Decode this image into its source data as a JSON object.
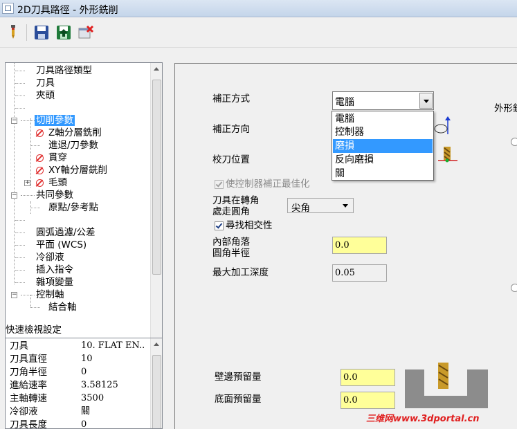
{
  "window": {
    "title": "2D刀具路徑 - 外形銑削"
  },
  "toolbar": {
    "icons": [
      "tool-icon",
      "save-icon",
      "save-green-icon",
      "delete-icon"
    ]
  },
  "tree": {
    "items": [
      {
        "label": "刀具路徑類型"
      },
      {
        "label": "刀具"
      },
      {
        "label": "夾頭"
      },
      {
        "label": "切削參數",
        "selected": true
      },
      {
        "label": "Z軸分層銑削"
      },
      {
        "label": "進退/刀參數"
      },
      {
        "label": "貫穿"
      },
      {
        "label": "XY軸分層銑削"
      },
      {
        "label": "毛頭"
      },
      {
        "label": "共同參數"
      },
      {
        "label": "原點/參考點"
      },
      {
        "label": "圓弧過濾/公差"
      },
      {
        "label": "平面 (WCS)"
      },
      {
        "label": "冷卻液"
      },
      {
        "label": "插入指令"
      },
      {
        "label": "雜項變量"
      },
      {
        "label": "控制軸"
      },
      {
        "label": "結合軸"
      }
    ]
  },
  "quickview": {
    "title": "快速檢視設定",
    "rows": [
      {
        "k": "刀具",
        "v": "10. FLAT EN.."
      },
      {
        "k": "刀具直徑",
        "v": "10"
      },
      {
        "k": "刀角半徑",
        "v": "0"
      },
      {
        "k": "進給速率",
        "v": "3.58125"
      },
      {
        "k": "主軸轉速",
        "v": "3500"
      },
      {
        "k": "冷卻液",
        "v": "關"
      },
      {
        "k": "刀具長度",
        "v": "0"
      }
    ]
  },
  "params": {
    "comp_type_label": "補正方式",
    "comp_type_value": "電腦",
    "comp_options": [
      "電腦",
      "控制器",
      "磨損",
      "反向磨損",
      "關"
    ],
    "comp_selected_index": 2,
    "comp_dir_label": "補正方向",
    "tip_label": "校刀位置",
    "optimize_label": "使控制器補正最佳化",
    "corner_label_1": "刀具在轉角",
    "corner_label_2": "處走圓角",
    "corner_value": "尖角",
    "find_intersect_label": "尋找相交性",
    "inner_radius_label_1": "內部角落",
    "inner_radius_label_2": "圓角半徑",
    "inner_radius_value": "0.0",
    "max_depth_label": "最大加工深度",
    "max_depth_value": "0.05",
    "wall_stock_label": "壁邊預留量",
    "wall_stock_value": "0.0",
    "floor_stock_label": "底面預留量",
    "floor_stock_value": "0.0",
    "contour_type_label": "外形銑"
  },
  "watermark": "三维网www.3dportal.cn"
}
